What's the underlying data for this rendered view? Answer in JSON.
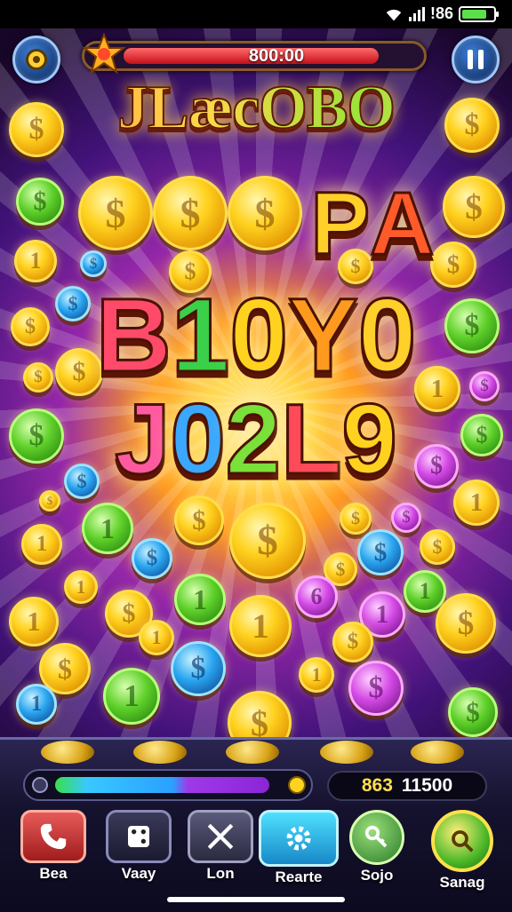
{
  "status_bar": {
    "time": "!86",
    "battery_level": 0.8
  },
  "top_bar": {
    "progress_text": "800:00",
    "progress_fraction": 0.87
  },
  "title": "JLæcOBO",
  "big_text": {
    "row1": [
      {
        "t": "P",
        "c": "#ffcf2a"
      },
      {
        "t": "A",
        "c": "#ff5a2a"
      }
    ],
    "row2": [
      {
        "t": "B",
        "c": "#ff4a6a"
      },
      {
        "t": "1",
        "c": "#3ad04a"
      },
      {
        "t": "0",
        "c": "#ffd21f"
      },
      {
        "t": "Y",
        "c": "#ff9a1f"
      },
      {
        "t": "0",
        "c": "#ffcf2a"
      }
    ],
    "row3": [
      {
        "t": "J",
        "c": "#ff5aa0"
      },
      {
        "t": "0",
        "c": "#3aa8ff"
      },
      {
        "t": "2",
        "c": "#7ae03a"
      },
      {
        "t": "L",
        "c": "#ff4a5a"
      },
      {
        "t": "9",
        "c": "#ffd21f"
      }
    ]
  },
  "energy_fraction": 0.92,
  "score": {
    "left": "863",
    "right": "11500"
  },
  "nav": {
    "home": "Bea",
    "play": "Vaay",
    "lon": "Lon",
    "reset": "Rearte",
    "sojo": "Sojo",
    "sanag": "Sanag"
  },
  "colors": {
    "accent_gold": "#ffd21f",
    "background_purple": "#3a1070"
  }
}
